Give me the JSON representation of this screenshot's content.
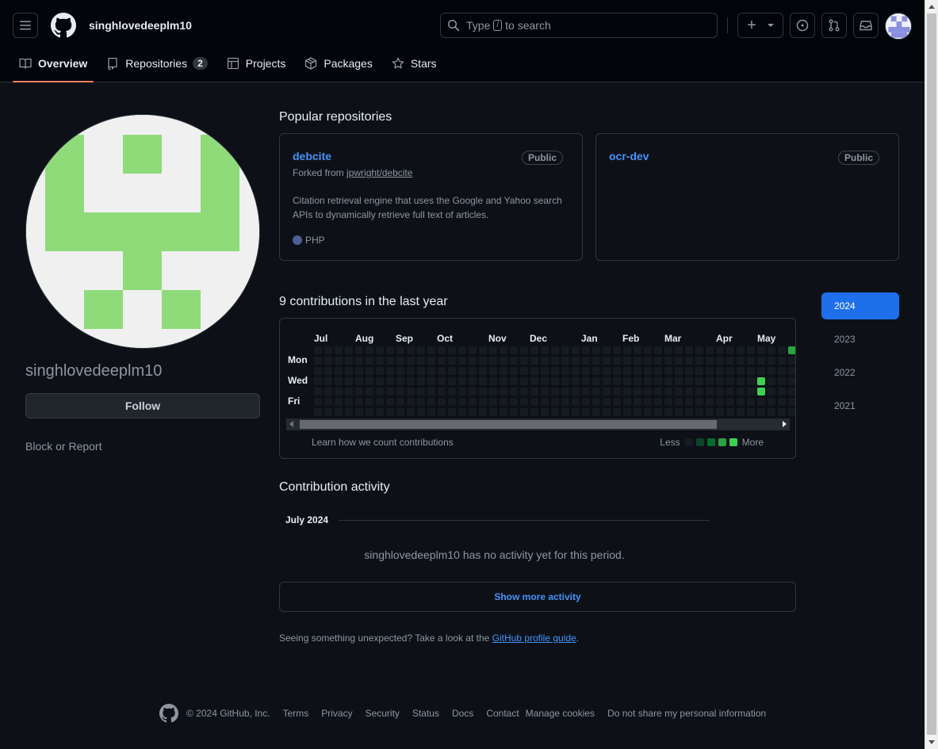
{
  "header": {
    "username": "singhlovedeeplm10",
    "search": {
      "prefix": "Type",
      "slash": "/",
      "suffix": "to search"
    },
    "plus_symbol": "+",
    "icons": [
      "menu-icon",
      "github-logo-icon",
      "search-icon",
      "plus-icon",
      "chevron-down-icon",
      "issues-icon",
      "pull-requests-icon",
      "inbox-icon"
    ]
  },
  "tabs": [
    {
      "label": "Overview",
      "icon": "book-icon",
      "selected": true
    },
    {
      "label": "Repositories",
      "icon": "repo-icon",
      "count": "2"
    },
    {
      "label": "Projects",
      "icon": "table-icon"
    },
    {
      "label": "Packages",
      "icon": "package-icon"
    },
    {
      "label": "Stars",
      "icon": "star-icon"
    }
  ],
  "profile": {
    "name": "singhlovedeeplm10",
    "follow_label": "Follow",
    "block_report": "Block or Report",
    "avatar_colors": {
      "fg": "#8fdb7a",
      "bg": "#f0f0f0"
    }
  },
  "popular": {
    "title": "Popular repositories",
    "repos": [
      {
        "name": "debcite",
        "visibility": "Public",
        "fork_prefix": "Forked from",
        "fork_source": "jpwright/debcite",
        "description": "Citation retrieval engine that uses the Google and Yahoo search APIs to dynamically retrieve full text of articles.",
        "language": "PHP",
        "language_color": "#4F5D95"
      },
      {
        "name": "ocr-dev",
        "visibility": "Public"
      }
    ]
  },
  "contributions": {
    "title": "9 contributions in the last year",
    "months": [
      "Jul",
      "Aug",
      "Sep",
      "Oct",
      "Nov",
      "Dec",
      "Jan",
      "Feb",
      "Mar",
      "Apr",
      "May"
    ],
    "days": [
      "Mon",
      "Wed",
      "Fri"
    ],
    "learn": "Learn how we count contributions",
    "legend_less": "Less",
    "legend_more": "More",
    "legend_colors": [
      "#161b22",
      "#0e4429",
      "#006d32",
      "#26a641",
      "#39d353"
    ],
    "active_cells": [
      {
        "week": 43,
        "day": 3,
        "level": 4
      },
      {
        "week": 43,
        "day": 4,
        "level": 4
      },
      {
        "week": 46,
        "day": 0,
        "level": 3
      }
    ],
    "years": [
      "2024",
      "2023",
      "2022",
      "2021"
    ],
    "active_year": "2024"
  },
  "activity": {
    "title": "Contribution activity",
    "month": "July 2024",
    "empty": "singhlovedeeplm10 has no activity yet for this period.",
    "show_more": "Show more activity",
    "unexpected_prefix": "Seeing something unexpected? Take a look at the",
    "unexpected_link": "GitHub profile guide",
    "unexpected_suffix": "."
  },
  "footer": {
    "copyright": "© 2024 GitHub, Inc.",
    "links": [
      "Terms",
      "Privacy",
      "Security",
      "Status",
      "Docs",
      "Contact",
      "Manage cookies",
      "Do not share my personal information"
    ]
  },
  "colors": {
    "accent": "#4493f8",
    "tab_underline": "#f78166",
    "year_active": "#1f6feb"
  }
}
